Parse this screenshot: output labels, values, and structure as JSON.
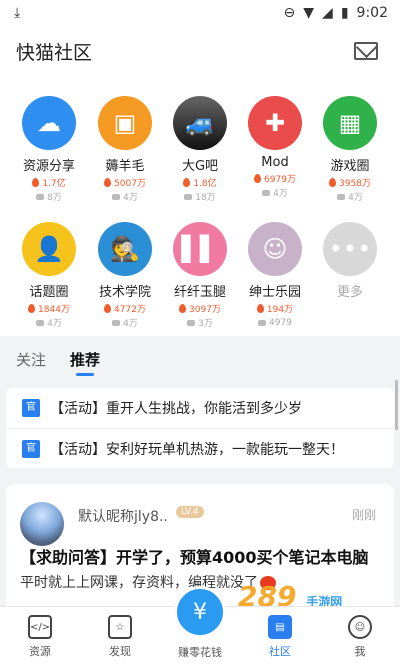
{
  "status": {
    "time": "9:02"
  },
  "header": {
    "title": "快猫社区"
  },
  "categories": [
    {
      "name": "资源分享",
      "heat": "1.7亿",
      "members": "8万",
      "color": "#2f8ff0",
      "icon": "cloud-upload-icon"
    },
    {
      "name": "薅羊毛",
      "heat": "5007万",
      "members": "4万",
      "color": "#f59a23",
      "icon": "gift-icon"
    },
    {
      "name": "大G吧",
      "heat": "1.8亿",
      "members": "18万",
      "color": "#2a2a2a",
      "icon": "car-photo"
    },
    {
      "name": "Mod",
      "heat": "6979万",
      "members": "4万",
      "color": "#ea4b4b",
      "icon": "gamepad-icon"
    },
    {
      "name": "游戏圈",
      "heat": "3958万",
      "members": "4万",
      "color": "#2fb24a",
      "icon": "store-icon"
    },
    {
      "name": "话题圈",
      "heat": "1844万",
      "members": "4万",
      "color": "#f6c21c",
      "icon": "user-hash-icon"
    },
    {
      "name": "技术学院",
      "heat": "4772万",
      "members": "4万",
      "color": "#2b8fd6",
      "icon": "spy-icon"
    },
    {
      "name": "纤纤玉腿",
      "heat": "3097万",
      "members": "3万",
      "color": "#f07aa0",
      "icon": "legs-photo"
    },
    {
      "name": "绅士乐园",
      "heat": "194万",
      "members": "4979",
      "color": "#c7b2c9",
      "icon": "anime-avatar"
    },
    {
      "name": "更多",
      "heat": "",
      "members": "",
      "color": "#d8d8d8",
      "icon": "more-dots-icon"
    }
  ],
  "tabs": {
    "follow": "关注",
    "recommend": "推荐"
  },
  "notices": [
    {
      "badge": "官",
      "text": "【活动】重开人生挑战，你能活到多少岁"
    },
    {
      "badge": "官",
      "text": "【活动】安利好玩单机热游，一款能玩一整天！"
    }
  ],
  "post": {
    "author": "默认昵称jly8..",
    "level": "LV.4",
    "time": "刚刚",
    "title": "【求助问答】开学了，预算4000买个笔记本电脑",
    "body": "平时就上上网课，存资料，编程就没了"
  },
  "nav": {
    "resources": "资源",
    "discover": "发现",
    "earn": "赚零花钱",
    "community": "社区",
    "me": "我"
  },
  "watermark": {
    "main": "289",
    "sub": "手游网"
  }
}
